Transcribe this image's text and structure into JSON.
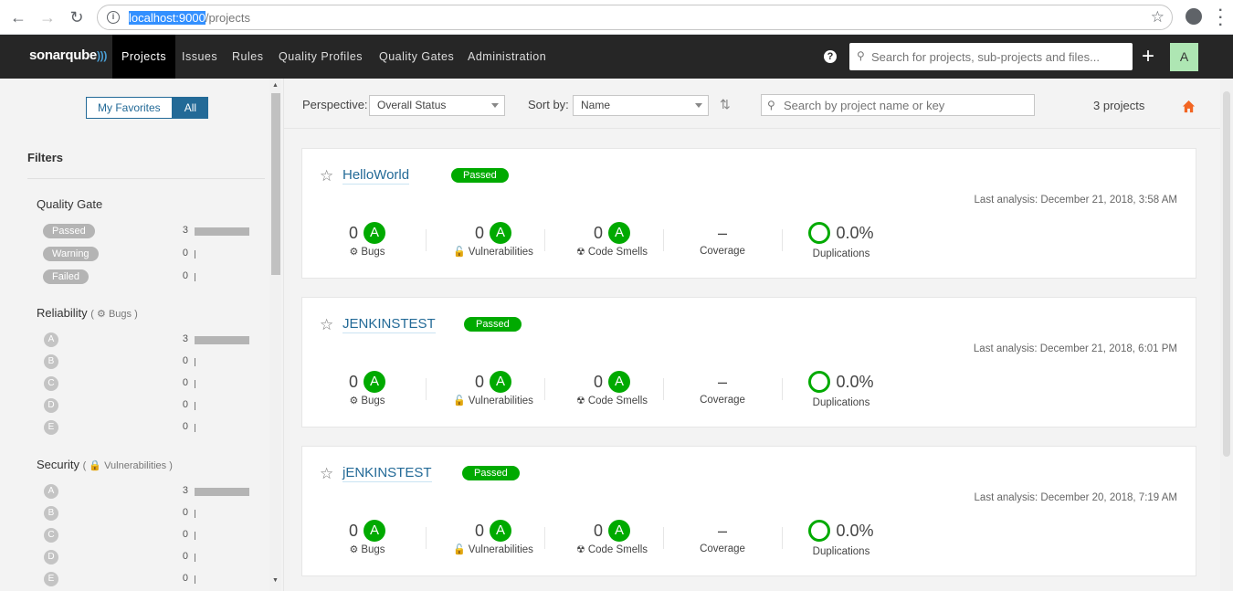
{
  "browser": {
    "url_host": "localhost:9000",
    "url_path": "/projects"
  },
  "nav": {
    "logo": "sonarqube",
    "items": [
      "Projects",
      "Issues",
      "Rules",
      "Quality Profiles",
      "Quality Gates",
      "Administration"
    ],
    "active": "Projects",
    "search_placeholder": "Search for projects, sub-projects and files...",
    "avatar_letter": "A"
  },
  "sidebar": {
    "toggle": {
      "favorites": "My Favorites",
      "all": "All",
      "selected": "All"
    },
    "filters_title": "Filters",
    "quality_gate": {
      "title": "Quality Gate",
      "options": [
        {
          "label": "Passed",
          "count": "3",
          "fraction": 1.0
        },
        {
          "label": "Warning",
          "count": "0",
          "fraction": 0
        },
        {
          "label": "Failed",
          "count": "0",
          "fraction": 0
        }
      ]
    },
    "reliability": {
      "title": "Reliability",
      "sub": "Bugs",
      "options": [
        {
          "label": "A",
          "count": "3",
          "fraction": 1.0
        },
        {
          "label": "B",
          "count": "0",
          "fraction": 0
        },
        {
          "label": "C",
          "count": "0",
          "fraction": 0
        },
        {
          "label": "D",
          "count": "0",
          "fraction": 0
        },
        {
          "label": "E",
          "count": "0",
          "fraction": 0
        }
      ]
    },
    "security": {
      "title": "Security",
      "sub": "Vulnerabilities",
      "options": [
        {
          "label": "A",
          "count": "3",
          "fraction": 1.0
        },
        {
          "label": "B",
          "count": "0",
          "fraction": 0
        },
        {
          "label": "C",
          "count": "0",
          "fraction": 0
        },
        {
          "label": "D",
          "count": "0",
          "fraction": 0
        },
        {
          "label": "E",
          "count": "0",
          "fraction": 0
        }
      ]
    }
  },
  "toolbar": {
    "perspective_label": "Perspective:",
    "perspective_value": "Overall Status",
    "sort_label": "Sort by:",
    "sort_value": "Name",
    "search_placeholder": "Search by project name or key",
    "project_count": "3 projects"
  },
  "projects": [
    {
      "name": "HelloWorld",
      "status": "Passed",
      "last_analysis": "Last analysis: December 21, 2018, 3:58 AM",
      "bugs": "0",
      "bugs_rating": "A",
      "vulnerabilities": "0",
      "vulnerabilities_rating": "A",
      "code_smells": "0",
      "code_smells_rating": "A",
      "coverage": "–",
      "duplications": "0.0%"
    },
    {
      "name": "JENKINSTEST",
      "status": "Passed",
      "last_analysis": "Last analysis: December 21, 2018, 6:01 PM",
      "bugs": "0",
      "bugs_rating": "A",
      "vulnerabilities": "0",
      "vulnerabilities_rating": "A",
      "code_smells": "0",
      "code_smells_rating": "A",
      "coverage": "–",
      "duplications": "0.0%"
    },
    {
      "name": "jENKINSTEST",
      "status": "Passed",
      "last_analysis": "Last analysis: December 20, 2018, 7:19 AM",
      "bugs": "0",
      "bugs_rating": "A",
      "vulnerabilities": "0",
      "vulnerabilities_rating": "A",
      "code_smells": "0",
      "code_smells_rating": "A",
      "coverage": "–",
      "duplications": "0.0%"
    }
  ],
  "measure_labels": {
    "bugs": "Bugs",
    "vulnerabilities": "Vulnerabilities",
    "code_smells": "Code Smells",
    "coverage": "Coverage",
    "duplications": "Duplications"
  },
  "colors": {
    "passed": "#00aa00",
    "link": "#236a97",
    "nav_bg": "#262626",
    "home": "#f26522"
  }
}
